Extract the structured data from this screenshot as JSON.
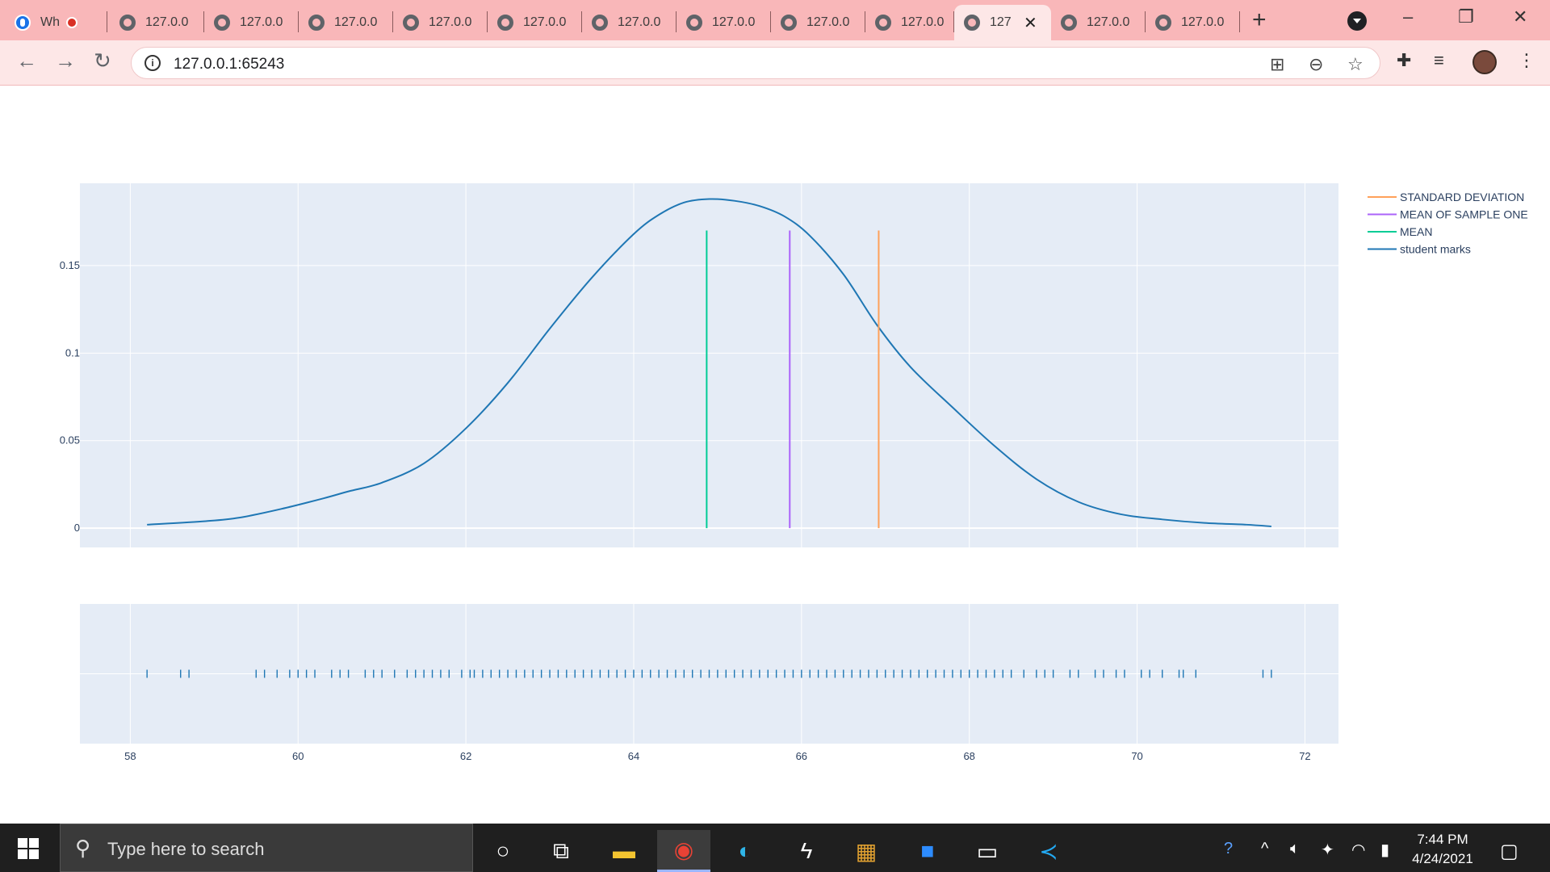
{
  "browser": {
    "tabs": [
      {
        "title": "Wh",
        "active": false,
        "recording": true
      },
      {
        "title": "127.0.0",
        "active": false
      },
      {
        "title": "127.0.0",
        "active": false
      },
      {
        "title": "127.0.0",
        "active": false
      },
      {
        "title": "127.0.0",
        "active": false
      },
      {
        "title": "127.0.0",
        "active": false
      },
      {
        "title": "127.0.0",
        "active": false
      },
      {
        "title": "127.0.0",
        "active": false
      },
      {
        "title": "127.0.0",
        "active": false
      },
      {
        "title": "127.0.0",
        "active": false
      },
      {
        "title": "127",
        "active": true
      },
      {
        "title": "127.0.0",
        "active": false
      },
      {
        "title": "127.0.0",
        "active": false
      }
    ],
    "url": "127.0.0.1:65243",
    "tab_color": "#f9b7b9"
  },
  "chart_data": {
    "type": "line",
    "title": "",
    "xlabel": "",
    "ylabel": "",
    "xlim": [
      57.4,
      72.4
    ],
    "ylim": [
      -0.011,
      0.197
    ],
    "xticks": [
      58,
      60,
      62,
      64,
      66,
      68,
      70,
      72
    ],
    "yticks": [
      0,
      0.05,
      0.1,
      0.15
    ],
    "ytick_labels": [
      "0",
      "0.05",
      "0.1",
      "0.15"
    ],
    "legend_position": "top-right",
    "series": [
      {
        "name": "student marks",
        "color": "#1f77b4",
        "x": [
          58.2,
          58.9,
          59.3,
          59.8,
          60.3,
          60.6,
          61.0,
          61.5,
          62.0,
          62.5,
          63.0,
          63.5,
          64.0,
          64.3,
          64.6,
          64.9,
          65.2,
          65.5,
          65.8,
          66.1,
          66.5,
          66.9,
          67.3,
          67.8,
          68.3,
          68.8,
          69.3,
          69.8,
          70.3,
          70.8,
          71.3,
          71.6
        ],
        "y": [
          0.002,
          0.004,
          0.006,
          0.011,
          0.017,
          0.021,
          0.026,
          0.037,
          0.057,
          0.083,
          0.114,
          0.143,
          0.168,
          0.179,
          0.186,
          0.188,
          0.187,
          0.184,
          0.178,
          0.167,
          0.145,
          0.116,
          0.092,
          0.069,
          0.047,
          0.028,
          0.015,
          0.008,
          0.005,
          0.003,
          0.002,
          0.001
        ]
      },
      {
        "name": "MEAN",
        "color": "#00cc96",
        "x": [
          64.87,
          64.87
        ],
        "y": [
          0,
          0.17
        ]
      },
      {
        "name": "MEAN OF SAMPLE ONE",
        "color": "#ab63fa",
        "x": [
          65.86,
          65.86
        ],
        "y": [
          0,
          0.17
        ]
      },
      {
        "name": "STANDARD DEVIATION",
        "color": "#ffa15a",
        "x": [
          66.92,
          66.92
        ],
        "y": [
          0,
          0.17
        ]
      }
    ],
    "legend_order": [
      "STANDARD DEVIATION",
      "MEAN OF SAMPLE ONE",
      "MEAN",
      "student marks"
    ],
    "rug": {
      "color": "#1f77b4",
      "values": [
        58.2,
        58.6,
        58.7,
        59.5,
        59.6,
        59.75,
        59.9,
        60.0,
        60.1,
        60.2,
        60.4,
        60.5,
        60.6,
        60.8,
        60.9,
        61.0,
        61.15,
        61.3,
        61.4,
        61.5,
        61.6,
        61.7,
        61.8,
        61.95,
        62.05,
        62.1,
        62.2,
        62.3,
        62.4,
        62.5,
        62.6,
        62.7,
        62.8,
        62.9,
        63.0,
        63.1,
        63.2,
        63.3,
        63.4,
        63.5,
        63.6,
        63.7,
        63.8,
        63.9,
        64.0,
        64.1,
        64.2,
        64.3,
        64.4,
        64.5,
        64.6,
        64.7,
        64.8,
        64.9,
        65.0,
        65.1,
        65.2,
        65.3,
        65.4,
        65.5,
        65.6,
        65.7,
        65.8,
        65.9,
        66.0,
        66.1,
        66.2,
        66.3,
        66.4,
        66.5,
        66.6,
        66.7,
        66.8,
        66.9,
        67.0,
        67.1,
        67.2,
        67.3,
        67.4,
        67.5,
        67.6,
        67.7,
        67.8,
        67.9,
        68.0,
        68.1,
        68.2,
        68.3,
        68.4,
        68.5,
        68.65,
        68.8,
        68.9,
        69.0,
        69.2,
        69.3,
        69.5,
        69.6,
        69.75,
        69.85,
        70.05,
        70.15,
        70.3,
        70.5,
        70.55,
        70.7,
        71.5,
        71.6
      ]
    }
  },
  "taskbar": {
    "search_placeholder": "Type here to search",
    "time": "7:44 PM",
    "date": "4/24/2021"
  }
}
